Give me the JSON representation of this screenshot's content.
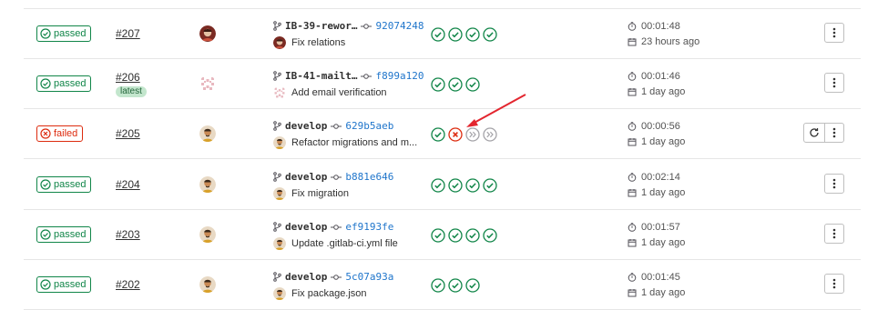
{
  "pipelines": [
    {
      "status": "passed",
      "status_label": "passed",
      "id": "#207",
      "badge": null,
      "avatar": "avatar-red",
      "ref": "IB-39-rewor…",
      "sha": "92074248",
      "message": "Fix relations",
      "stages": [
        "success",
        "success",
        "success",
        "success"
      ],
      "duration": "00:01:48",
      "finished": "23 hours ago",
      "retry": false
    },
    {
      "status": "passed",
      "status_label": "passed",
      "id": "#206",
      "badge": "latest",
      "avatar": "avatar-pattern",
      "ref": "IB-41-mailt…",
      "sha": "f899a120",
      "message": "Add email verification",
      "stages": [
        "success",
        "success",
        "success"
      ],
      "duration": "00:01:46",
      "finished": "1 day ago",
      "retry": false
    },
    {
      "status": "failed",
      "status_label": "failed",
      "id": "#205",
      "badge": null,
      "avatar": "avatar-person",
      "ref": "develop",
      "sha": "629b5aeb",
      "message": "Refactor migrations and m...",
      "stages": [
        "success",
        "failed",
        "skipped",
        "skipped"
      ],
      "duration": "00:00:56",
      "finished": "1 day ago",
      "retry": true
    },
    {
      "status": "passed",
      "status_label": "passed",
      "id": "#204",
      "badge": null,
      "avatar": "avatar-person",
      "ref": "develop",
      "sha": "b881e646",
      "message": "Fix migration",
      "stages": [
        "success",
        "success",
        "success",
        "success"
      ],
      "duration": "00:02:14",
      "finished": "1 day ago",
      "retry": false
    },
    {
      "status": "passed",
      "status_label": "passed",
      "id": "#203",
      "badge": null,
      "avatar": "avatar-person",
      "ref": "develop",
      "sha": "ef9193fe",
      "message": "Update .gitlab-ci.yml file",
      "stages": [
        "success",
        "success",
        "success",
        "success"
      ],
      "duration": "00:01:57",
      "finished": "1 day ago",
      "retry": false
    },
    {
      "status": "passed",
      "status_label": "passed",
      "id": "#202",
      "badge": null,
      "avatar": "avatar-person",
      "ref": "develop",
      "sha": "5c07a93a",
      "message": "Fix package.json",
      "stages": [
        "success",
        "success",
        "success"
      ],
      "duration": "00:01:45",
      "finished": "1 day ago",
      "retry": false
    }
  ],
  "colors": {
    "success": "#108548",
    "failed": "#dd2b0e",
    "skipped": "#a4a3a8",
    "link": "#1f75cb",
    "annotation": "#e3262f"
  }
}
